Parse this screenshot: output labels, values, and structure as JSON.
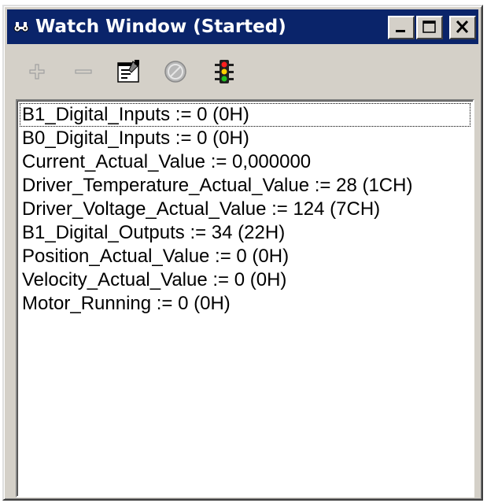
{
  "window": {
    "title": "Watch Window (Started)",
    "title_icon": "watch-glasses-icon",
    "caption_buttons": [
      "minimize-icon",
      "maximize-icon",
      "close-icon"
    ],
    "colors": {
      "titlebar": "#0a246a",
      "face": "#d4d0c8",
      "list_background": "#ffffff"
    }
  },
  "toolbar": {
    "items": [
      {
        "name": "add",
        "icon": "plus-icon",
        "enabled": false
      },
      {
        "name": "remove",
        "icon": "minus-icon",
        "enabled": false
      },
      {
        "name": "properties",
        "icon": "properties-icon",
        "enabled": true
      },
      {
        "name": "stop",
        "icon": "stop-icon",
        "enabled": false
      },
      {
        "name": "run",
        "icon": "traffic-light-icon",
        "enabled": true
      }
    ]
  },
  "watch_list": {
    "focused_index": 0,
    "items": [
      "B1_Digital_Inputs := 0 (0H)",
      "B0_Digital_Inputs := 0 (0H)",
      "Current_Actual_Value := 0,000000",
      "Driver_Temperature_Actual_Value := 28 (1CH)",
      "Driver_Voltage_Actual_Value := 124 (7CH)",
      "B1_Digital_Outputs := 34 (22H)",
      "Position_Actual_Value := 0 (0H)",
      "Velocity_Actual_Value := 0 (0H)",
      "Motor_Running := 0 (0H)"
    ]
  }
}
